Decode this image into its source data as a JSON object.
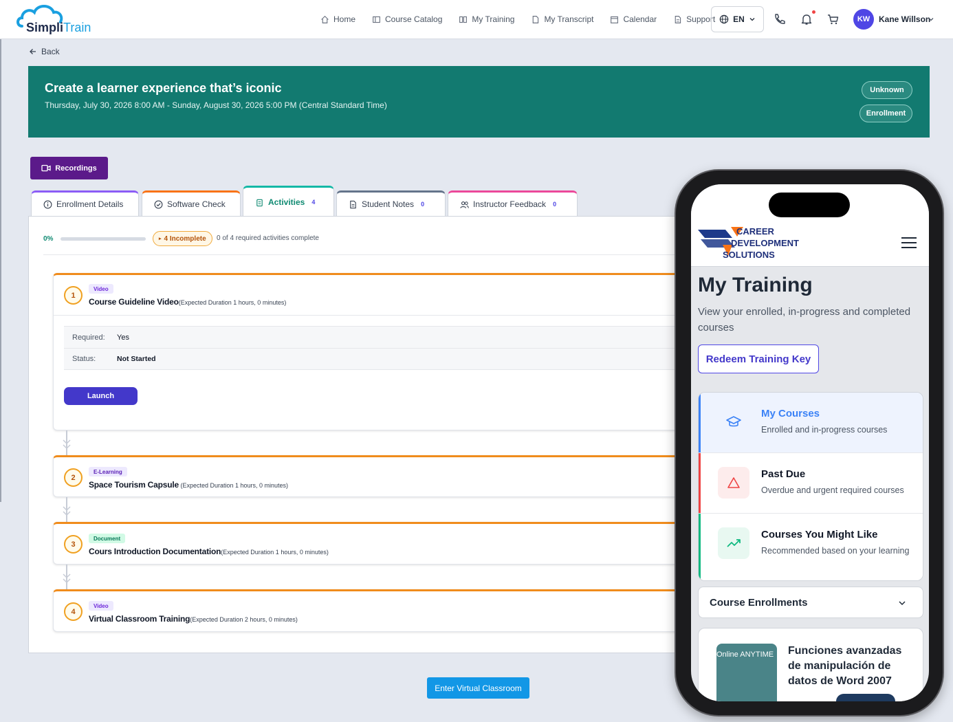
{
  "brand": {
    "name_a": "Simpli",
    "name_b": "Train"
  },
  "nav": {
    "items": [
      {
        "label": "Home",
        "icon": "home-icon"
      },
      {
        "label": "Course Catalog",
        "icon": "catalog-icon"
      },
      {
        "label": "My Training",
        "icon": "book-icon"
      },
      {
        "label": "My Transcript",
        "icon": "document-icon"
      },
      {
        "label": "Calendar",
        "icon": "calendar-icon"
      },
      {
        "label": "Support",
        "icon": "support-icon"
      }
    ],
    "language": "EN",
    "user_initials": "KW",
    "user_name": "Kane Willson"
  },
  "back_label": "Back",
  "banner": {
    "title": "Create a learner experience that’s iconic",
    "date_range": "Thursday, July 30, 2026 8:00 AM - Sunday, August 30, 2026 5:00 PM (Central Standard Time)",
    "status_pill": "Unknown",
    "type_pill": "Enrollment"
  },
  "recordings_label": "Recordings",
  "tabs": [
    {
      "label": "Enrollment Details",
      "count": "",
      "color": "#8b5cf6"
    },
    {
      "label": "Software Check",
      "count": "",
      "color": "#f97316"
    },
    {
      "label": "Activities",
      "count": "4",
      "color": "#14b8a6"
    },
    {
      "label": "Student Notes",
      "count": "0",
      "color": "#64748b"
    },
    {
      "label": "Instructor Feedback",
      "count": "0",
      "color": "#ec4899"
    }
  ],
  "progress": {
    "percent_label": "0%",
    "fraction": 0,
    "incomplete_label": "4 Incomplete",
    "summary": "0 of 4 required activities complete"
  },
  "activities": [
    {
      "num": "1",
      "type": "Video",
      "title": "Course Guideline Video",
      "duration": "(Expected Duration 1 hours, 0 minutes)"
    },
    {
      "num": "2",
      "type": "E-Learning",
      "title": "Space Tourism Capsule",
      "duration": " (Expected Duration 1 hours, 0 minutes)"
    },
    {
      "num": "3",
      "type": "Document",
      "title": "Cours Introduction Documentation",
      "duration": "(Expected Duration 1 hours, 0 minutes)"
    },
    {
      "num": "4",
      "type": "Video",
      "title": "Virtual Classroom Training",
      "duration": "(Expected Duration 2 hours, 0 minutes)"
    }
  ],
  "activity_detail": {
    "required_label": "Required:",
    "required_value": "Yes",
    "status_label": "Status:",
    "status_value": "Not Started",
    "launch_label": "Launch"
  },
  "enter_vc_label": "Enter Virtual Classroom",
  "mobile": {
    "logo_lines": [
      "CAREER",
      "DEVELOPMENT",
      "SOLUTIONS"
    ],
    "title": "My Training",
    "subtitle": "View your enrolled, in-progress and completed courses",
    "redeem_label": "Redeem Training Key",
    "cards": [
      {
        "title": "My Courses",
        "desc": "Enrolled and in-progress courses",
        "color": "#3b82f6",
        "icon": "graduation-cap-icon"
      },
      {
        "title": "Past Due",
        "desc": "Overdue and urgent required courses",
        "color": "#ef4444",
        "icon": "alert-triangle-icon"
      },
      {
        "title": "Courses You Might Like",
        "desc": "Recommended based on your learning",
        "color": "#10b981",
        "icon": "trending-up-icon"
      }
    ],
    "enrollments_label": "Course Enrollments",
    "course_thumb_label": "Online ANYTIME",
    "course_title": "Funciones avanzadas de manipulación de datos de Word 2007"
  }
}
